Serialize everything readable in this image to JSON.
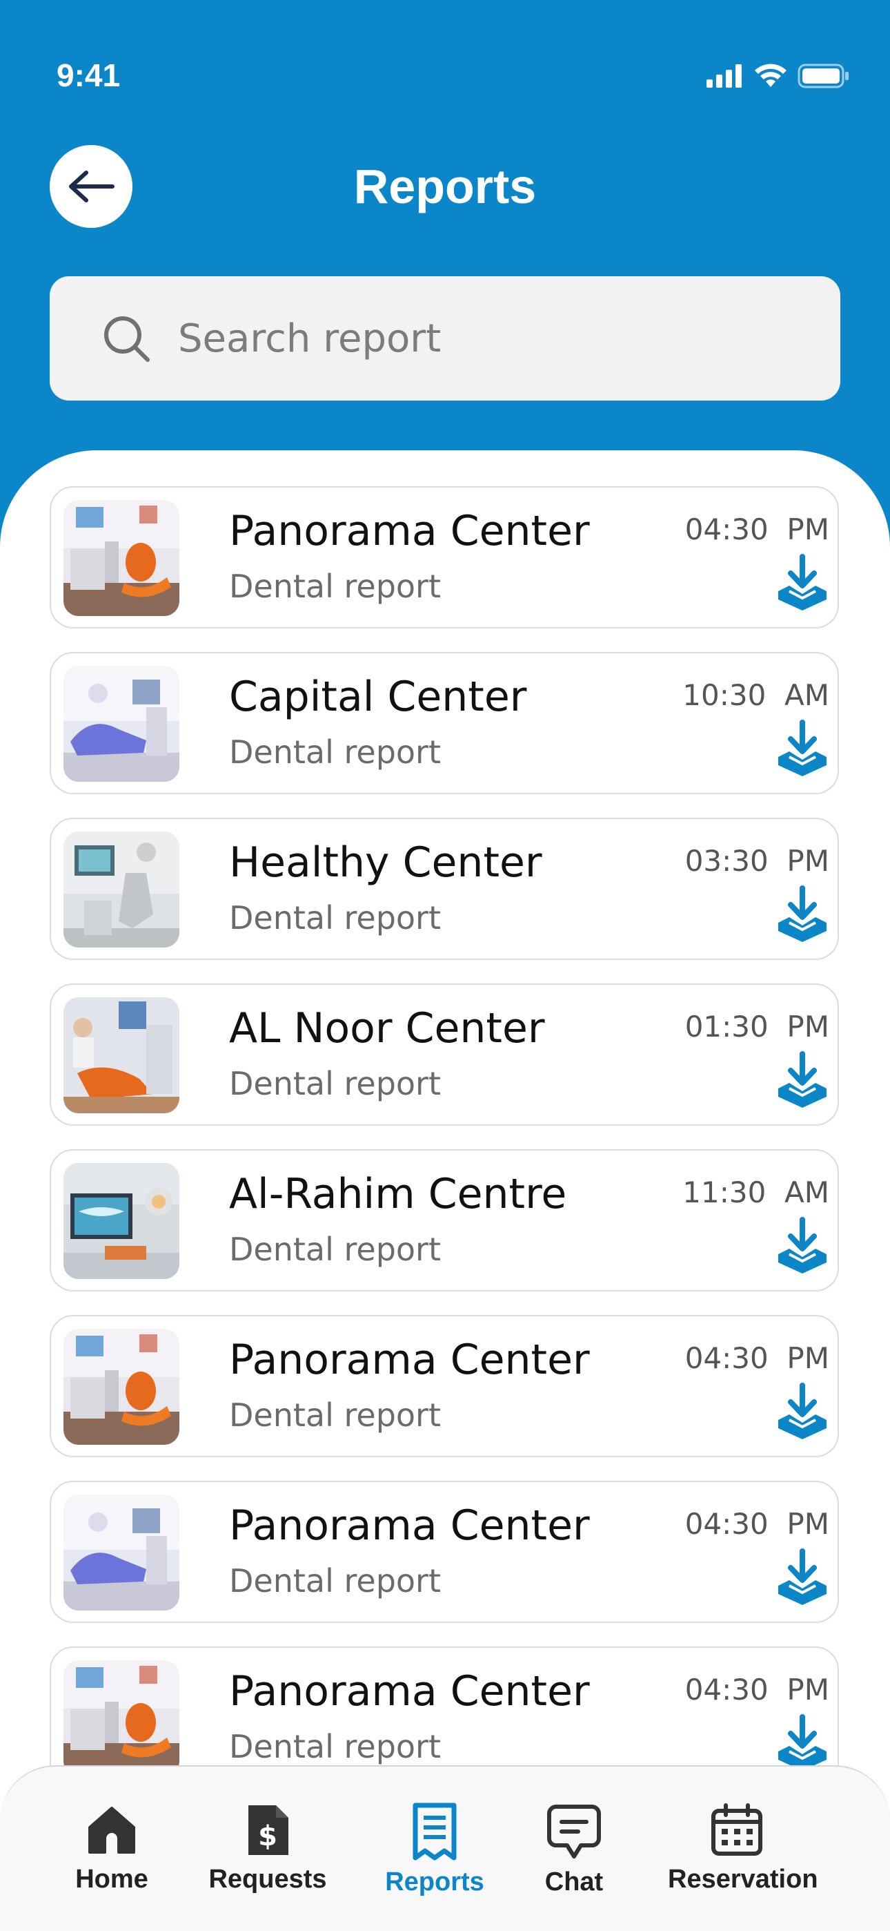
{
  "status": {
    "time": "9:41"
  },
  "header": {
    "title": "Reports"
  },
  "search": {
    "placeholder": "Search report"
  },
  "reports": [
    {
      "name": "Panorama Center",
      "subtitle": "Dental report",
      "time": "04:30  PM",
      "photo": "orange-chair-clinic"
    },
    {
      "name": "Capital Center",
      "subtitle": "Dental report",
      "time": "10:30  AM",
      "photo": "blue-chair-clinic"
    },
    {
      "name": "Healthy Center",
      "subtitle": "Dental report",
      "time": "03:30  PM",
      "photo": "grey-chair-clinic"
    },
    {
      "name": "AL Noor Center",
      "subtitle": "Dental report",
      "time": "01:30  PM",
      "photo": "dentist-orange-chair"
    },
    {
      "name": "Al-Rahim Centre",
      "subtitle": "Dental report",
      "time": "11:30  AM",
      "photo": "xray-screen-clinic"
    },
    {
      "name": "Panorama Center",
      "subtitle": "Dental report",
      "time": "04:30  PM",
      "photo": "orange-chair-clinic"
    },
    {
      "name": "Panorama Center",
      "subtitle": "Dental report",
      "time": "04:30  PM",
      "photo": "blue-chair-clinic"
    },
    {
      "name": "Panorama Center",
      "subtitle": "Dental report",
      "time": "04:30  PM",
      "photo": "orange-chair-clinic"
    }
  ],
  "tabs": [
    {
      "label": "Home",
      "icon": "home-icon",
      "active": false
    },
    {
      "label": "Requests",
      "icon": "invoice-icon",
      "active": false
    },
    {
      "label": "Reports",
      "icon": "report-icon",
      "active": true
    },
    {
      "label": "Chat",
      "icon": "chat-icon",
      "active": false
    },
    {
      "label": "Reservation",
      "icon": "calendar-icon",
      "active": false
    }
  ],
  "colors": {
    "brand": "#0a86c9",
    "active_tab": "#0a86c9",
    "inactive_tab": "#333333"
  }
}
